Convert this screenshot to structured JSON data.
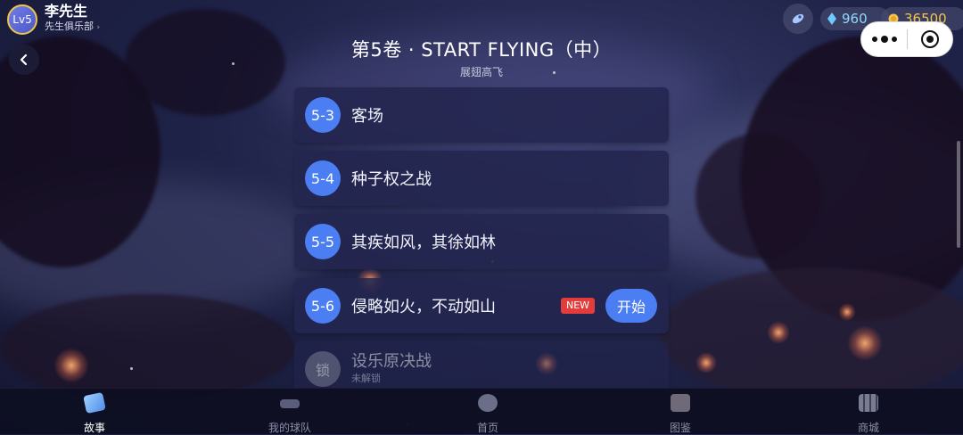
{
  "profile": {
    "level": "Lv5",
    "name": "李先生",
    "club": "先生俱乐部"
  },
  "currency": {
    "gems": "960",
    "coins": "36500"
  },
  "volume": {
    "title": "第5卷 · START FLYING（中）",
    "subtitle": "展翅高飞"
  },
  "chapters": [
    {
      "num": "5-3",
      "title": "客场"
    },
    {
      "num": "5-4",
      "title": "种子权之战"
    },
    {
      "num": "5-5",
      "title": "其疾如风，其徐如林"
    },
    {
      "num": "5-6",
      "title": "侵略如火，不动如山",
      "badge": "NEW",
      "action": "开始"
    }
  ],
  "locked_chapter": {
    "icon_label": "锁",
    "title": "设乐原决战",
    "status": "未解锁"
  },
  "bottom_nav": [
    {
      "label": "故事",
      "active": true,
      "icon": "story-icon"
    },
    {
      "label": "我的球队",
      "active": false,
      "icon": "team-icon"
    },
    {
      "label": "首页",
      "active": false,
      "icon": "home-icon"
    },
    {
      "label": "图鉴",
      "active": false,
      "icon": "collection-icon"
    },
    {
      "label": "商城",
      "active": false,
      "icon": "shop-icon"
    }
  ],
  "colors": {
    "accent": "#4a7ef2",
    "badge": "#e23c3c",
    "coin": "#f6c34b",
    "gem": "#8fd8ff"
  }
}
